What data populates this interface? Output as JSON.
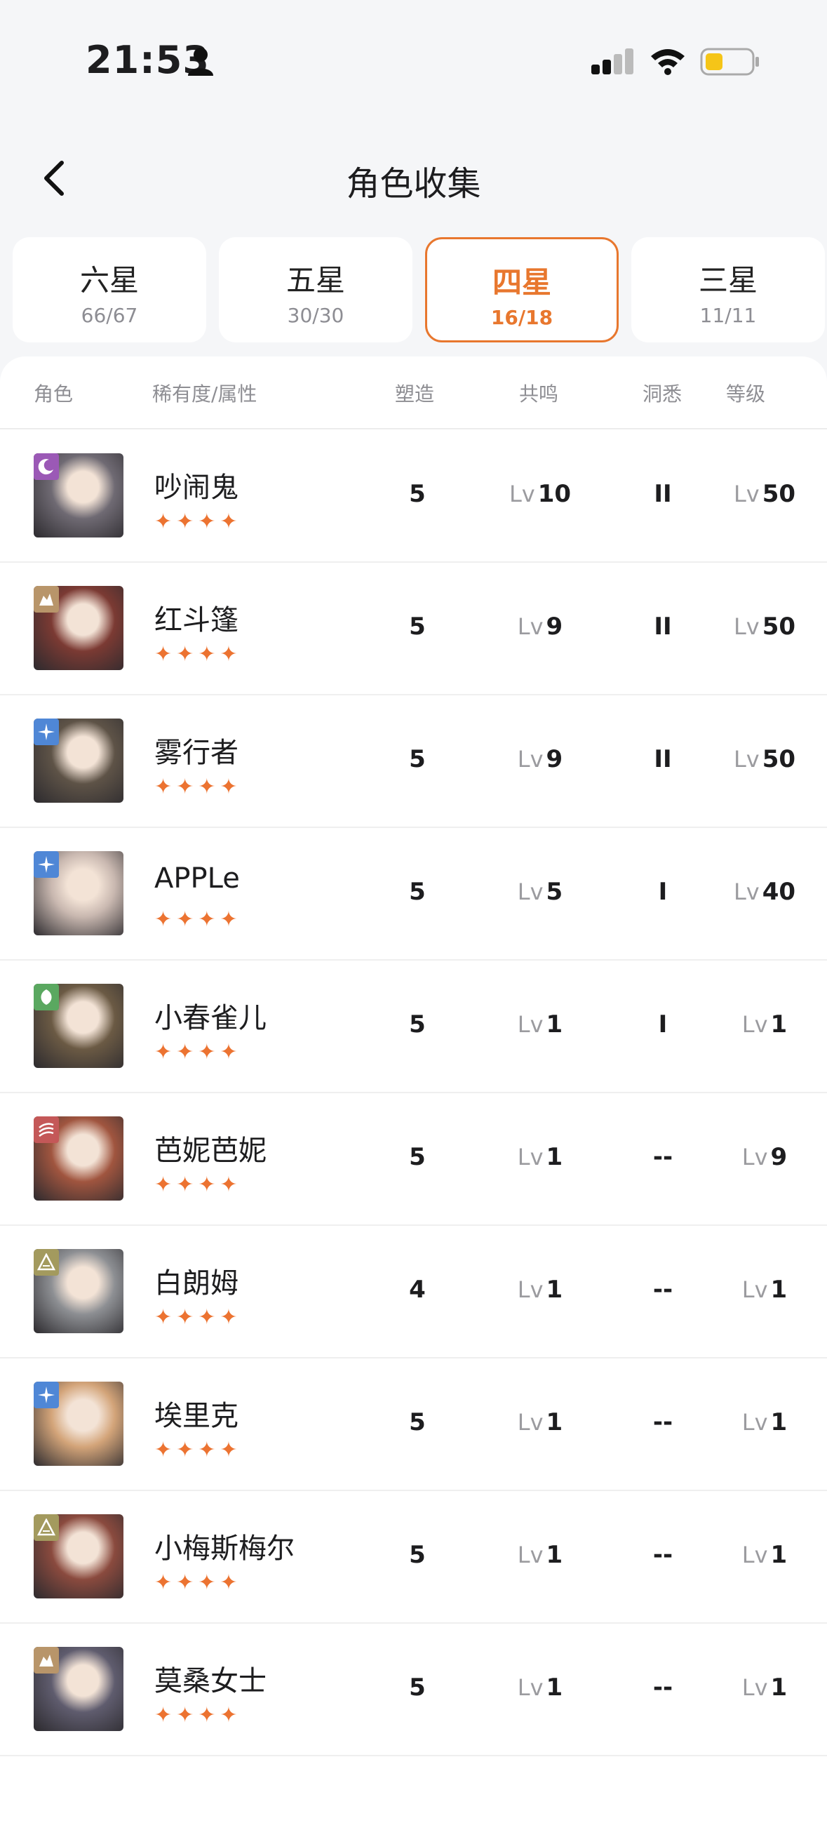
{
  "status_bar": {
    "time": "21:53"
  },
  "nav": {
    "title": "角色收集"
  },
  "tabs": [
    {
      "name": "六星",
      "count": "66/67"
    },
    {
      "name": "五星",
      "count": "30/30"
    },
    {
      "name": "四星",
      "count": "16/18"
    },
    {
      "name": "三星",
      "count": "11/11"
    }
  ],
  "table": {
    "headers": {
      "role": "角色",
      "rarity": "稀有度/属性",
      "forge": "塑造",
      "resonance": "共鸣",
      "insight": "洞悉",
      "level": "等级"
    },
    "lv_prefix": "Lv",
    "stars": "✦✦✦✦",
    "rows": [
      {
        "name": "吵闹鬼",
        "forge": "5",
        "resonance": "10",
        "insight": "II",
        "level": "50",
        "element": "moon-icon",
        "color": "#9b59b6"
      },
      {
        "name": "红斗篷",
        "forge": "5",
        "resonance": "9",
        "insight": "II",
        "level": "50",
        "element": "rock-icon",
        "color": "#b8956a"
      },
      {
        "name": "雾行者",
        "forge": "5",
        "resonance": "9",
        "insight": "II",
        "level": "50",
        "element": "star-icon",
        "color": "#4f87d6"
      },
      {
        "name": "APPLe",
        "forge": "5",
        "resonance": "5",
        "insight": "I",
        "level": "40",
        "element": "star-icon",
        "color": "#4f87d6"
      },
      {
        "name": "小春雀儿",
        "forge": "5",
        "resonance": "1",
        "insight": "I",
        "level": "1",
        "element": "leaf-icon",
        "color": "#5aa860"
      },
      {
        "name": "芭妮芭妮",
        "forge": "5",
        "resonance": "1",
        "insight": "--",
        "level": "9",
        "element": "flame-icon",
        "color": "#c45858"
      },
      {
        "name": "白朗姆",
        "forge": "4",
        "resonance": "1",
        "insight": "--",
        "level": "1",
        "element": "triangle-icon",
        "color": "#a39a5e"
      },
      {
        "name": "埃里克",
        "forge": "5",
        "resonance": "1",
        "insight": "--",
        "level": "1",
        "element": "star-icon",
        "color": "#4f87d6"
      },
      {
        "name": "小梅斯梅尔",
        "forge": "5",
        "resonance": "1",
        "insight": "--",
        "level": "1",
        "element": "triangle-icon",
        "color": "#a39a5e"
      },
      {
        "name": "莫桑女士",
        "forge": "5",
        "resonance": "1",
        "insight": "--",
        "level": "1",
        "element": "rock-icon",
        "color": "#b8956a"
      }
    ]
  },
  "colors": {
    "accent": "#e8772e",
    "star": "#ec7331",
    "background": "#f5f6f8"
  }
}
